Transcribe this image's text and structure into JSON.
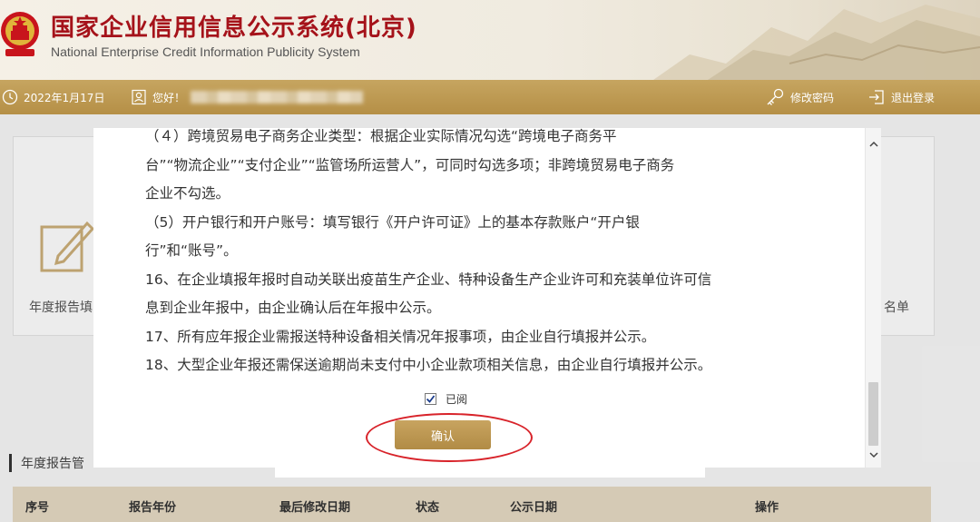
{
  "header": {
    "title_cn": "国家企业信用信息公示系统(北京)",
    "title_en": "National Enterprise Credit Information Publicity System"
  },
  "topbar": {
    "date": "2022年1月17日",
    "greeting": "您好！",
    "change_password": "修改密码",
    "logout": "退出登录"
  },
  "background": {
    "annual_report_fill": "年度报告填",
    "list_label": "名单",
    "section_title": "年度报告管",
    "table_headers": [
      "序号",
      "报告年份",
      "最后修改日期",
      "状态",
      "公示日期",
      "操作"
    ]
  },
  "modal": {
    "lines": [
      "（４）跨境贸易电子商务企业类型：根据企业实际情况勾选“跨境电子商务平",
      "台”“物流企业”“支付企业”“监管场所运营人”，可同时勾选多项；非跨境贸易电子商务",
      "企业不勾选。",
      "（5）开户银行和开户账号：填写银行《开户许可证》上的基本存款账户“开户银",
      "行”和“账号”。",
      "16、在企业填报年报时自动关联出疫苗生产企业、特种设备生产企业许可和充装单位许可信",
      "息到企业年报中，由企业确认后在年报中公示。",
      "17、所有应年报企业需报送特种设备相关情况年报事项，由企业自行填报并公示。",
      "18、大型企业年报还需保送逾期尚未支付中小企业款项相关信息，由企业自行填报并公示。"
    ],
    "read_label": "已阅",
    "read_checked": true,
    "confirm_label": "确认"
  },
  "colors": {
    "brand_red": "#a5121a",
    "gold": "#b58f46",
    "highlight_red": "#d8232a"
  }
}
